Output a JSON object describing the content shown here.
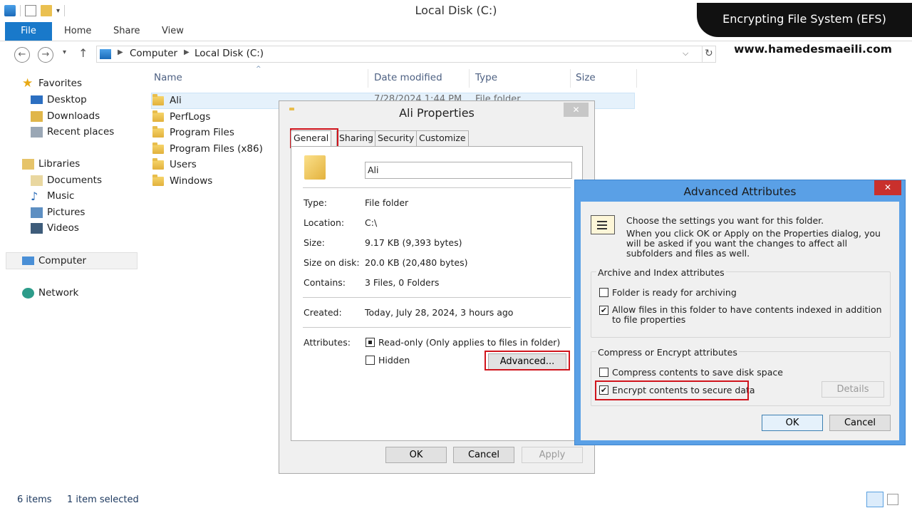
{
  "window": {
    "title": "Local Disk (C:)"
  },
  "ribbon": {
    "tabs": [
      "File",
      "Home",
      "Share",
      "View"
    ]
  },
  "address": {
    "crumbs": [
      "Computer",
      "Local Disk (C:)"
    ]
  },
  "nav": {
    "favorites": "Favorites",
    "desktop": "Desktop",
    "downloads": "Downloads",
    "recent": "Recent places",
    "libraries": "Libraries",
    "documents": "Documents",
    "music": "Music",
    "pictures": "Pictures",
    "videos": "Videos",
    "computer": "Computer",
    "network": "Network"
  },
  "columns": {
    "name": "Name",
    "date": "Date modified",
    "type": "Type",
    "size": "Size"
  },
  "files": [
    {
      "name": "Ali",
      "date": "7/28/2024 1:44 PM",
      "type": "File folder"
    },
    {
      "name": "PerfLogs"
    },
    {
      "name": "Program Files"
    },
    {
      "name": "Program Files (x86)"
    },
    {
      "name": "Users"
    },
    {
      "name": "Windows"
    }
  ],
  "status": {
    "items": "6 items",
    "selected": "1 item selected"
  },
  "properties": {
    "title": "Ali Properties",
    "tabs": [
      "General",
      "Sharing",
      "Security",
      "Customize"
    ],
    "name_value": "Ali",
    "rows": [
      {
        "label": "Type:",
        "value": "File folder"
      },
      {
        "label": "Location:",
        "value": "C:\\"
      },
      {
        "label": "Size:",
        "value": "9.17 KB (9,393 bytes)"
      },
      {
        "label": "Size on disk:",
        "value": "20.0 KB (20,480 bytes)"
      },
      {
        "label": "Contains:",
        "value": "3 Files, 0 Folders"
      },
      {
        "label": "Created:",
        "value": "Today, July 28, 2024, 3 hours ago"
      }
    ],
    "attributes_label": "Attributes:",
    "readonly": "Read-only (Only applies to files in folder)",
    "hidden": "Hidden",
    "advanced": "Advanced...",
    "ok": "OK",
    "cancel": "Cancel",
    "apply": "Apply",
    "close": "✕"
  },
  "advanced": {
    "title": "Advanced Attributes",
    "intro": "Choose the settings you want for this folder.",
    "intro2": "When you click OK or Apply on the Properties dialog, you will be asked if you want the changes to affect all subfolders and files as well.",
    "group1": "Archive and Index attributes",
    "archive": "Folder is ready for archiving",
    "index": "Allow files in this folder to have contents indexed in addition to file properties",
    "group2": "Compress or Encrypt attributes",
    "compress": "Compress contents to save disk space",
    "encrypt": "Encrypt contents to secure data",
    "details": "Details",
    "ok": "OK",
    "cancel": "Cancel",
    "close": "✕",
    "index_checked": true,
    "encrypt_checked": true
  },
  "overlay": {
    "banner": "Encrypting File System (EFS)",
    "website": "www.hamedesmaeili.com"
  },
  "colors": {
    "accent": "#1979ca",
    "highlight": "#d0141c",
    "dialog_border": "#4a90d9"
  }
}
